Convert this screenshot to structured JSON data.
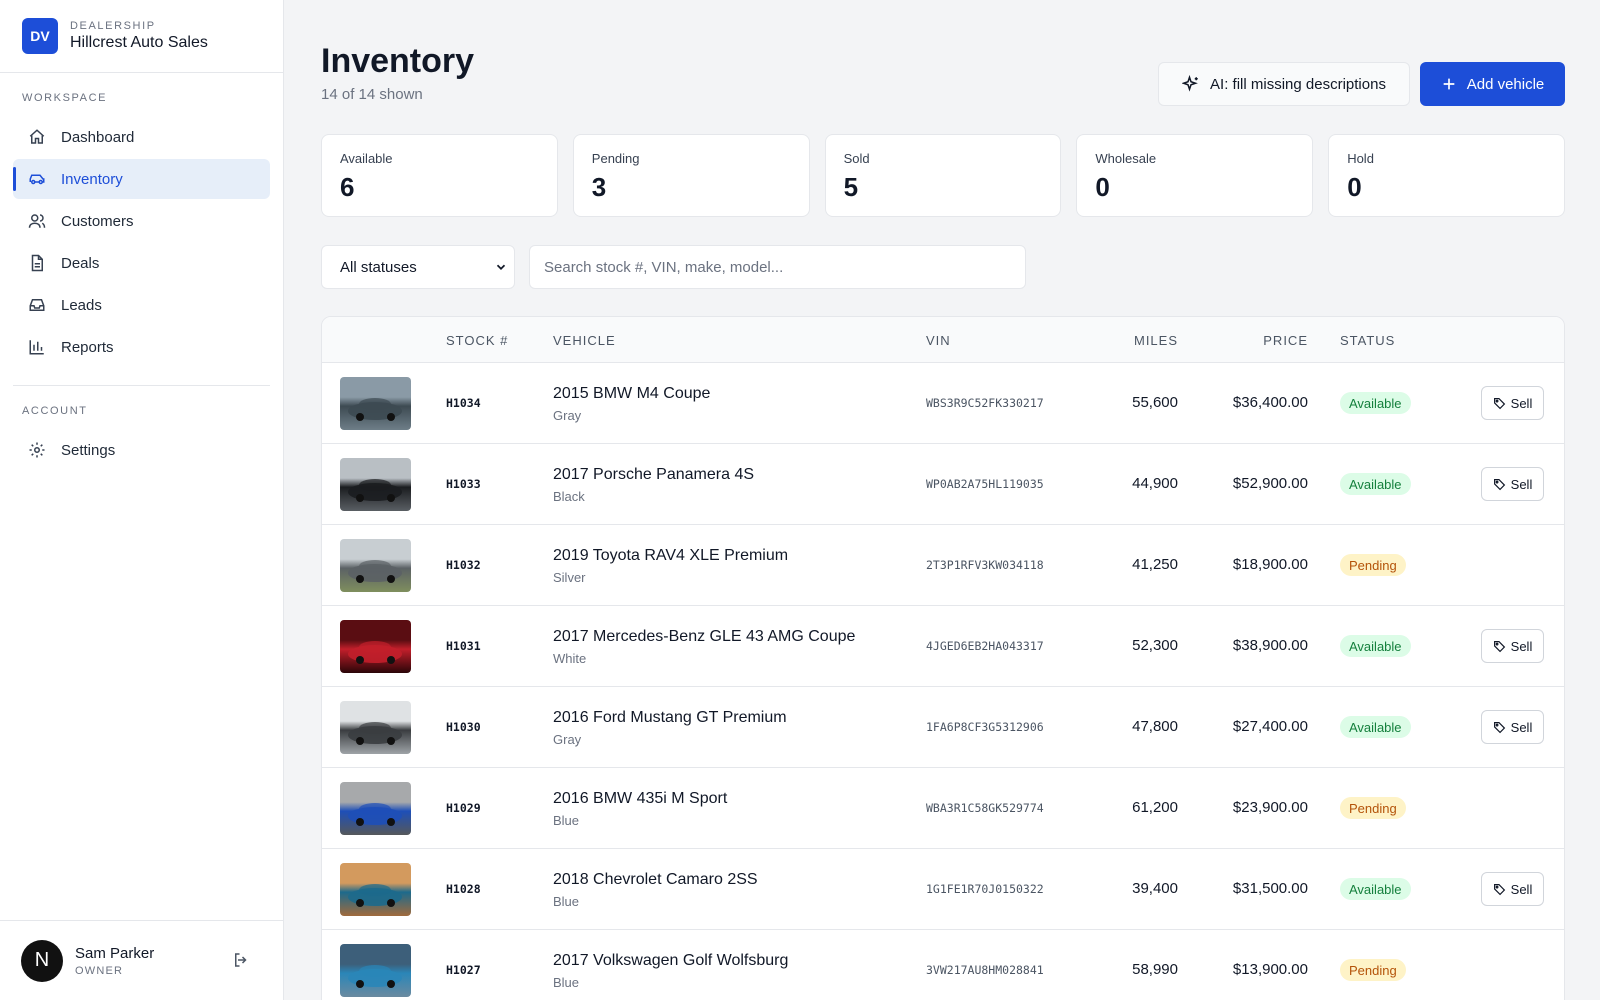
{
  "brand": {
    "logo": "DV",
    "eyebrow": "DEALERSHIP",
    "name": "Hillcrest Auto Sales"
  },
  "sidebar": {
    "workspace_label": "WORKSPACE",
    "account_label": "ACCOUNT",
    "items": [
      {
        "label": "Dashboard",
        "icon": "home-icon"
      },
      {
        "label": "Inventory",
        "icon": "car-icon",
        "active": true
      },
      {
        "label": "Customers",
        "icon": "users-icon"
      },
      {
        "label": "Deals",
        "icon": "document-icon"
      },
      {
        "label": "Leads",
        "icon": "inbox-icon"
      },
      {
        "label": "Reports",
        "icon": "bar-chart-icon"
      }
    ],
    "account_items": [
      {
        "label": "Settings",
        "icon": "gear-icon"
      }
    ]
  },
  "user": {
    "initial": "N",
    "name": "Sam Parker",
    "role": "OWNER"
  },
  "header": {
    "title": "Inventory",
    "subtitle": "14 of 14 shown",
    "ai_button": "AI: fill missing descriptions",
    "add_button": "Add vehicle"
  },
  "summary": [
    {
      "label": "Available",
      "value": "6"
    },
    {
      "label": "Pending",
      "value": "3"
    },
    {
      "label": "Sold",
      "value": "5"
    },
    {
      "label": "Wholesale",
      "value": "0"
    },
    {
      "label": "Hold",
      "value": "0"
    }
  ],
  "filters": {
    "status_selected": "All statuses",
    "search_placeholder": "Search stock #, VIN, make, model..."
  },
  "table": {
    "columns": {
      "stock": "STOCK #",
      "vehicle": "VEHICLE",
      "vin": "VIN",
      "miles": "MILES",
      "price": "PRICE",
      "status": "STATUS"
    },
    "sell_label": "Sell",
    "rows": [
      {
        "stock": "H1034",
        "vehicle": "2015 BMW M4 Coupe",
        "color": "Gray",
        "vin": "WBS3R9C52FK330217",
        "miles": "55,600",
        "price": "$36,400.00",
        "status": "Available",
        "sell": true,
        "thumb": [
          "#8a9aa6",
          "#3d4a52",
          "#6e7e88"
        ]
      },
      {
        "stock": "H1033",
        "vehicle": "2017 Porsche Panamera 4S",
        "color": "Black",
        "vin": "WP0AB2A75HL119035",
        "miles": "44,900",
        "price": "$52,900.00",
        "status": "Available",
        "sell": true,
        "thumb": [
          "#b9bfc4",
          "#1b1d20",
          "#5a5f64"
        ]
      },
      {
        "stock": "H1032",
        "vehicle": "2019 Toyota RAV4 XLE Premium",
        "color": "Silver",
        "vin": "2T3P1RFV3KW034118",
        "miles": "41,250",
        "price": "$18,900.00",
        "status": "Pending",
        "sell": false,
        "thumb": [
          "#c8ced2",
          "#5b6165",
          "#7f8f5e"
        ]
      },
      {
        "stock": "H1031",
        "vehicle": "2017 Mercedes-Benz GLE 43 AMG Coupe",
        "color": "White",
        "vin": "4JGED6EB2HA043317",
        "miles": "52,300",
        "price": "$38,900.00",
        "status": "Available",
        "sell": true,
        "thumb": [
          "#5a0d12",
          "#c21f2b",
          "#2a0508"
        ]
      },
      {
        "stock": "H1030",
        "vehicle": "2016 Ford Mustang GT Premium",
        "color": "Gray",
        "vin": "1FA6P8CF3G5312906",
        "miles": "47,800",
        "price": "$27,400.00",
        "status": "Available",
        "sell": true,
        "thumb": [
          "#dfe2e4",
          "#3a3d40",
          "#9ea3a7"
        ]
      },
      {
        "stock": "H1029",
        "vehicle": "2016 BMW 435i M Sport",
        "color": "Blue",
        "vin": "WBA3R1C58GK529774",
        "miles": "61,200",
        "price": "$23,900.00",
        "status": "Pending",
        "sell": false,
        "thumb": [
          "#a7a9ab",
          "#1e4fb8",
          "#55585a"
        ]
      },
      {
        "stock": "H1028",
        "vehicle": "2018 Chevrolet Camaro 2SS",
        "color": "Blue",
        "vin": "1G1FE1R70J0150322",
        "miles": "39,400",
        "price": "$31,500.00",
        "status": "Available",
        "sell": true,
        "thumb": [
          "#d39a5e",
          "#1d6a8c",
          "#a06a3c"
        ]
      },
      {
        "stock": "H1027",
        "vehicle": "2017 Volkswagen Golf Wolfsburg",
        "color": "Blue",
        "vin": "3VW217AU8HM028841",
        "miles": "58,990",
        "price": "$13,900.00",
        "status": "Pending",
        "sell": false,
        "thumb": [
          "#3d5f7a",
          "#2a86b8",
          "#6b8aa0"
        ]
      }
    ]
  }
}
